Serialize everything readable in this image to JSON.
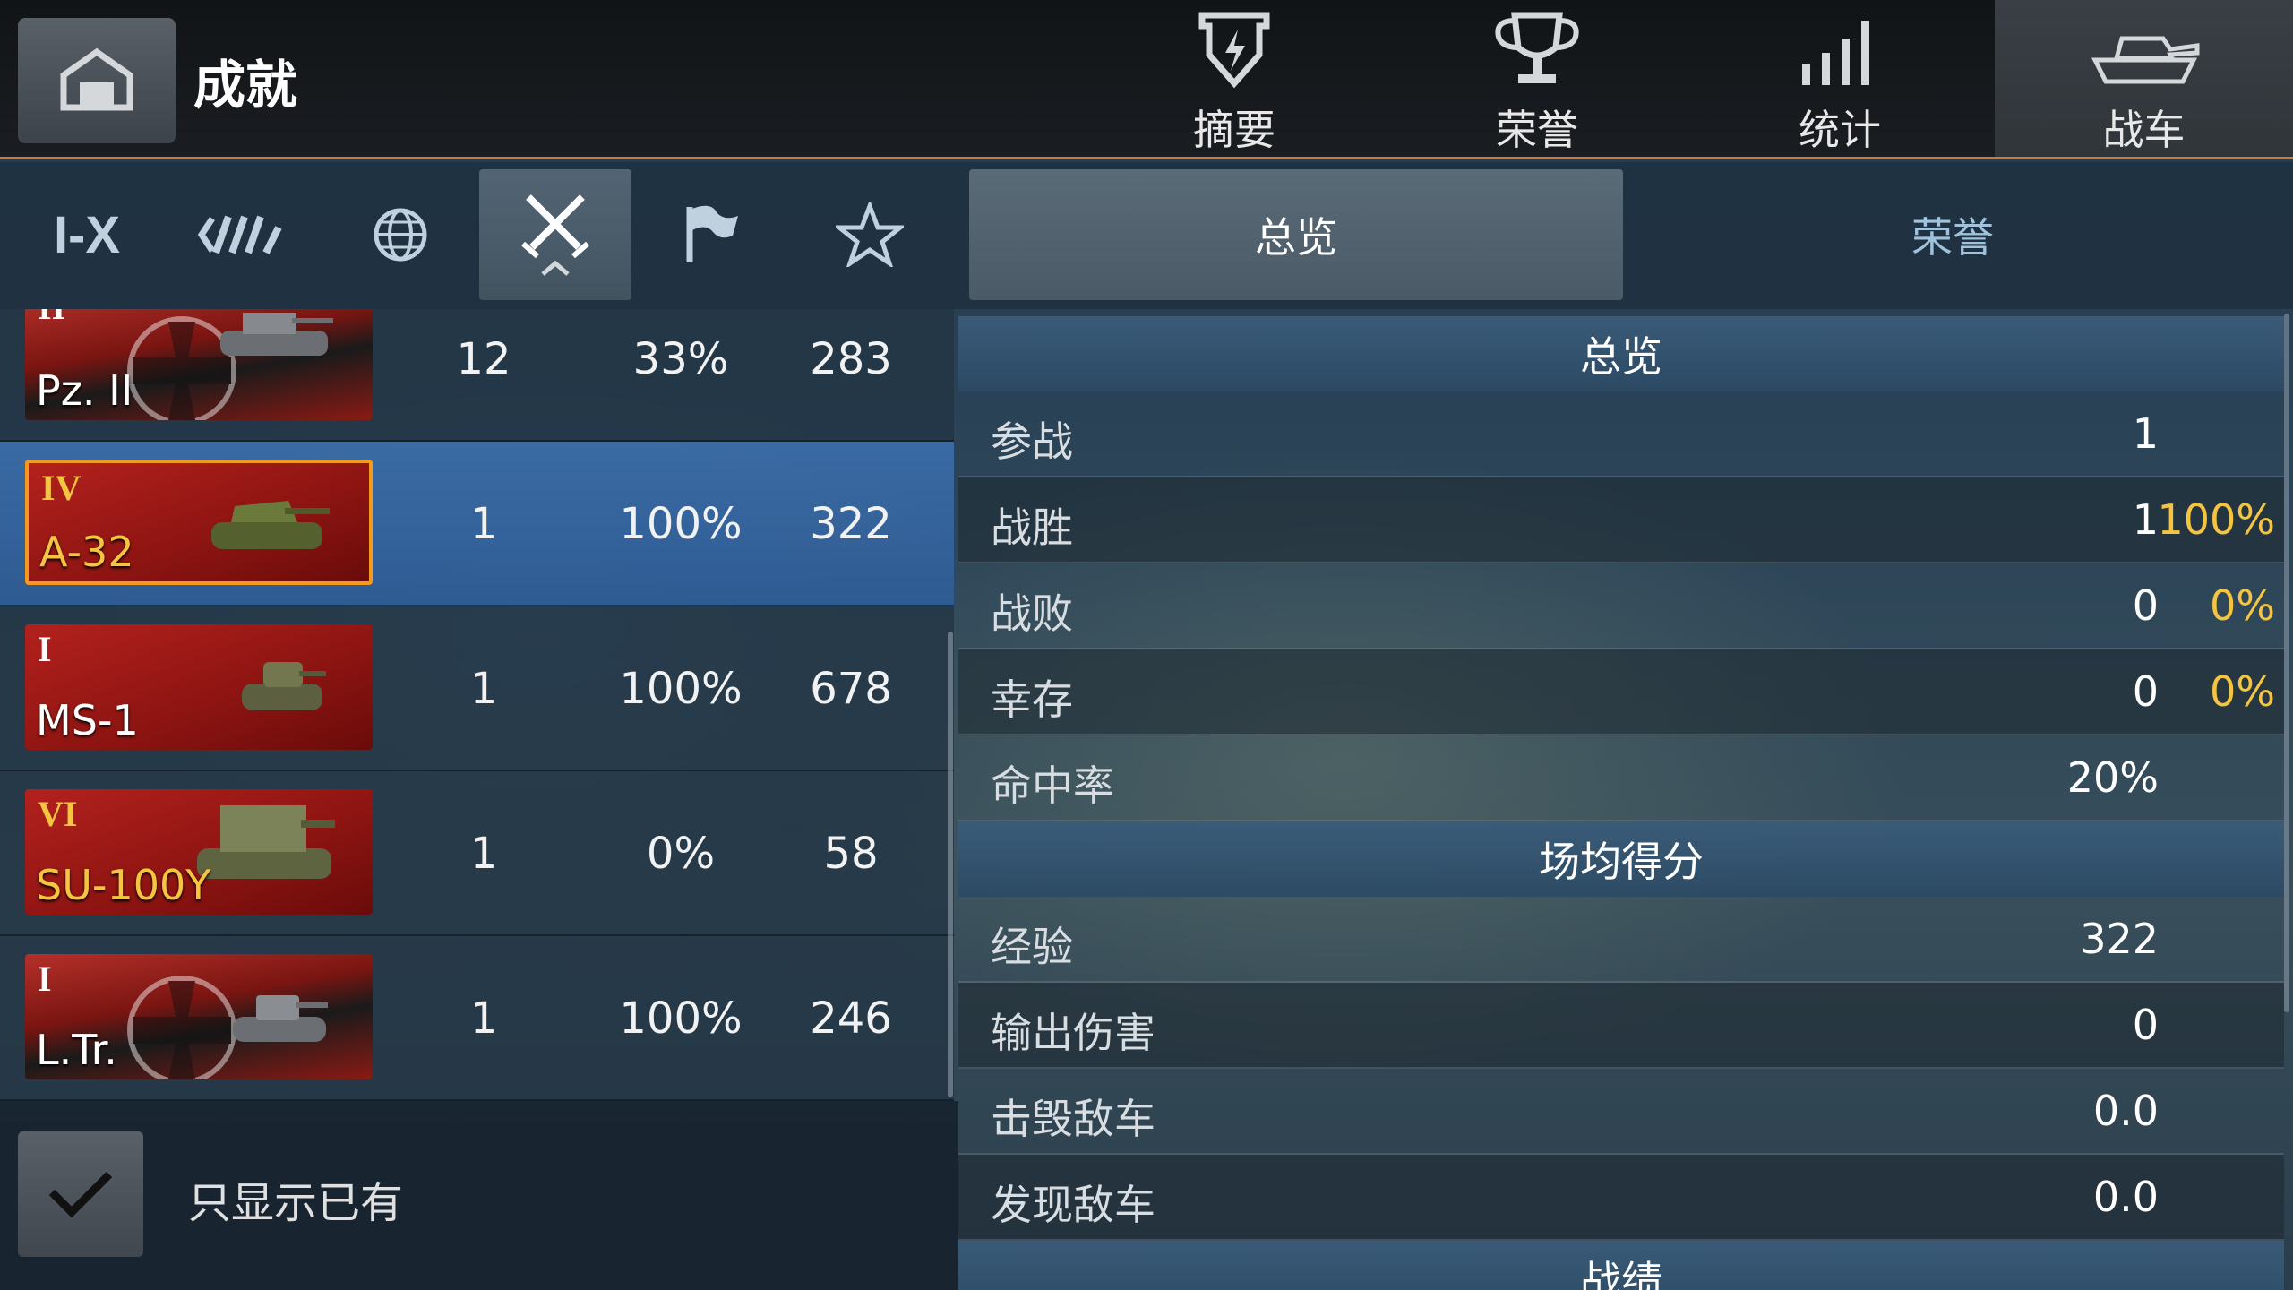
{
  "header": {
    "title": "成就",
    "tabs": [
      {
        "label": "摘要",
        "icon": "shield-icon"
      },
      {
        "label": "荣誉",
        "icon": "trophy-icon"
      },
      {
        "label": "统计",
        "icon": "bar-signal-icon"
      },
      {
        "label": "战车",
        "icon": "tank-icon"
      }
    ],
    "active_tab": "战车"
  },
  "filters": {
    "items": [
      "I-X",
      "nation-icon",
      "globe-icon",
      "crossed-swords-icon",
      "flag-icon",
      "star-icon"
    ],
    "tier_label": "I-X",
    "active": "crossed-swords-icon"
  },
  "vehicles": [
    {
      "tier": "II",
      "name": "Pz. II",
      "nation": "germany",
      "battles": "12",
      "winrate": "33%",
      "score": "283"
    },
    {
      "tier": "IV",
      "name": "A-32",
      "nation": "ussr",
      "premium": true,
      "battles": "1",
      "winrate": "100%",
      "score": "322"
    },
    {
      "tier": "I",
      "name": "MS-1",
      "nation": "ussr",
      "battles": "1",
      "winrate": "100%",
      "score": "678"
    },
    {
      "tier": "VI",
      "name": "SU-100Y",
      "nation": "ussr",
      "premium": true,
      "battles": "1",
      "winrate": "0%",
      "score": "58"
    },
    {
      "tier": "I",
      "name": "L.Tr.",
      "nation": "germany",
      "battles": "1",
      "winrate": "100%",
      "score": "246"
    }
  ],
  "own_toggle": {
    "label": "只显示已有",
    "checked": true
  },
  "detail_tabs": {
    "overview": "总览",
    "honors": "荣誉"
  },
  "stats": {
    "section1": "总览",
    "rows1": [
      {
        "label": "参战",
        "value": "1",
        "pct": ""
      },
      {
        "label": "战胜",
        "value": "1",
        "pct": "100%"
      },
      {
        "label": "战败",
        "value": "0",
        "pct": "0%"
      },
      {
        "label": "幸存",
        "value": "0",
        "pct": "0%"
      },
      {
        "label": "命中率",
        "value": "20%",
        "pct": ""
      }
    ],
    "section2": "场均得分",
    "rows2": [
      {
        "label": "经验",
        "value": "322"
      },
      {
        "label": "输出伤害",
        "value": "0"
      },
      {
        "label": "击毁敌车",
        "value": "0.0"
      },
      {
        "label": "发现敌车",
        "value": "0.0"
      }
    ],
    "section3": "战绩"
  },
  "colors": {
    "accent": "#d07a2e",
    "gold": "#f5c542",
    "selected": "#2e5c96"
  }
}
